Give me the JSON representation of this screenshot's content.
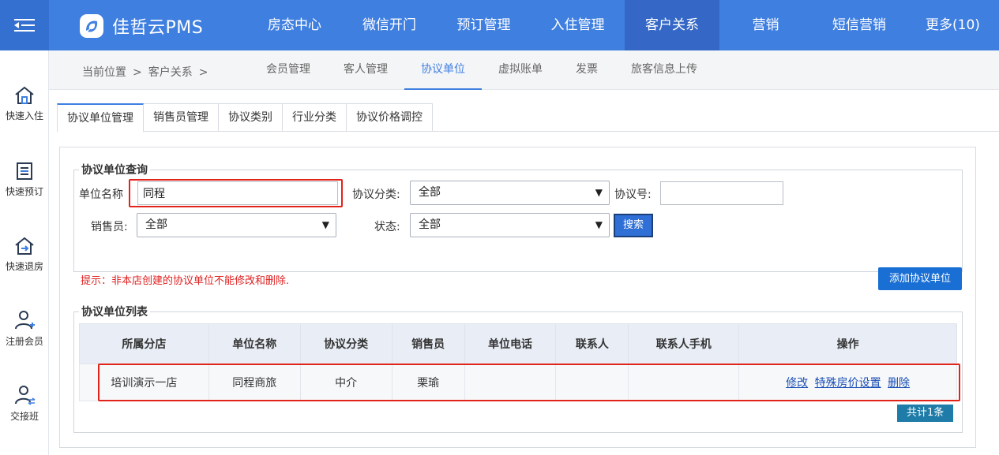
{
  "header": {
    "logo_text": "佳哲云PMS",
    "nav": [
      "房态中心",
      "微信开门",
      "预订管理",
      "入住管理",
      "客户关系",
      "营销",
      "短信营销",
      "更多(10)"
    ],
    "active_nav": "客户关系"
  },
  "sidebar": {
    "items": [
      {
        "label": "快速入住",
        "icon": "home-icon"
      },
      {
        "label": "快速预订",
        "icon": "list-icon"
      },
      {
        "label": "快速退房",
        "icon": "checkout-icon"
      },
      {
        "label": "注册会员",
        "icon": "add-user-icon"
      },
      {
        "label": "交接班",
        "icon": "swap-user-icon"
      }
    ]
  },
  "breadcrumb": {
    "prefix": "当前位置",
    "current": "客户关系",
    "sep": ">"
  },
  "subnav": [
    "会员管理",
    "客人管理",
    "协议单位",
    "虚拟账单",
    "发票",
    "旅客信息上传"
  ],
  "active_subnav": "协议单位",
  "tabs": [
    "协议单位管理",
    "销售员管理",
    "协议类别",
    "行业分类",
    "协议价格调控"
  ],
  "active_tab": "协议单位管理",
  "query": {
    "legend": "协议单位查询",
    "name_label": "单位名称",
    "name_value": "同程",
    "category_label": "协议分类:",
    "category_value": "全部",
    "number_label": "协议号:",
    "number_value": "",
    "seller_label": "销售员:",
    "seller_value": "全部",
    "status_label": "状态:",
    "status_value": "全部",
    "search_btn": "搜索"
  },
  "hint": "提示：非本店创建的协议单位不能修改和删除.",
  "add_btn": "添加协议单位",
  "list": {
    "legend": "协议单位列表",
    "columns": [
      "所属分店",
      "单位名称",
      "协议分类",
      "销售员",
      "单位电话",
      "联系人",
      "联系人手机",
      "操作"
    ],
    "rows": [
      {
        "branch": "培训演示一店",
        "name": "同程商旅",
        "category": "中介",
        "seller": "栗瑜",
        "phone": "",
        "contact": "",
        "contact_mobile": "",
        "actions": {
          "edit": "修改",
          "special_price": "特殊房价设置",
          "delete": "删除"
        }
      }
    ],
    "total": "共计1条"
  },
  "colors": {
    "brand": "#3f7fe0",
    "highlight": "#e2231a",
    "hint": "#e02020"
  }
}
